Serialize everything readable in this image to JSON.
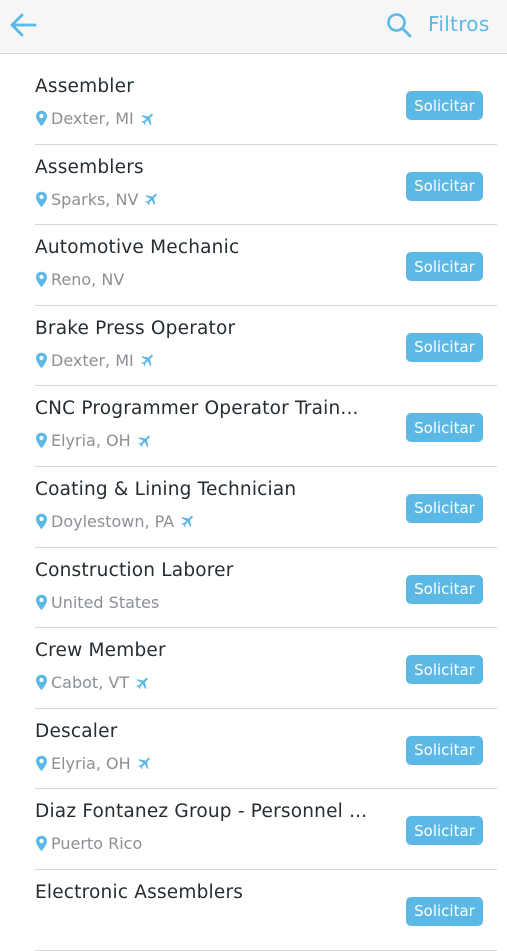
{
  "header": {
    "back_icon": "arrow-left-icon",
    "search_icon": "search-icon",
    "filters_label": "Filtros",
    "accent_color": "#5cb8e4"
  },
  "jobs": [
    {
      "title": "Assembler",
      "location": "Dexter, MI",
      "relocation": true,
      "apply_label": "Solicitar"
    },
    {
      "title": "Assemblers",
      "location": "Sparks, NV",
      "relocation": true,
      "apply_label": "Solicitar"
    },
    {
      "title": "Automotive Mechanic",
      "location": "Reno, NV",
      "relocation": false,
      "apply_label": "Solicitar"
    },
    {
      "title": "Brake Press Operator",
      "location": "Dexter, MI",
      "relocation": true,
      "apply_label": "Solicitar"
    },
    {
      "title": "CNC Programmer Operator Train...",
      "location": "Elyria, OH",
      "relocation": true,
      "apply_label": "Solicitar"
    },
    {
      "title": "Coating & Lining Technician",
      "location": "Doylestown, PA",
      "relocation": true,
      "apply_label": "Solicitar"
    },
    {
      "title": "Construction Laborer",
      "location": "United States",
      "relocation": false,
      "apply_label": "Solicitar"
    },
    {
      "title": "Crew Member",
      "location": "Cabot, VT",
      "relocation": true,
      "apply_label": "Solicitar"
    },
    {
      "title": "Descaler",
      "location": "Elyria, OH",
      "relocation": true,
      "apply_label": "Solicitar"
    },
    {
      "title": "Diaz Fontanez Group - Personnel ...",
      "location": "Puerto Rico",
      "relocation": false,
      "apply_label": "Solicitar"
    },
    {
      "title": "Electronic Assemblers",
      "location": "",
      "relocation": false,
      "apply_label": "Solicitar"
    }
  ]
}
